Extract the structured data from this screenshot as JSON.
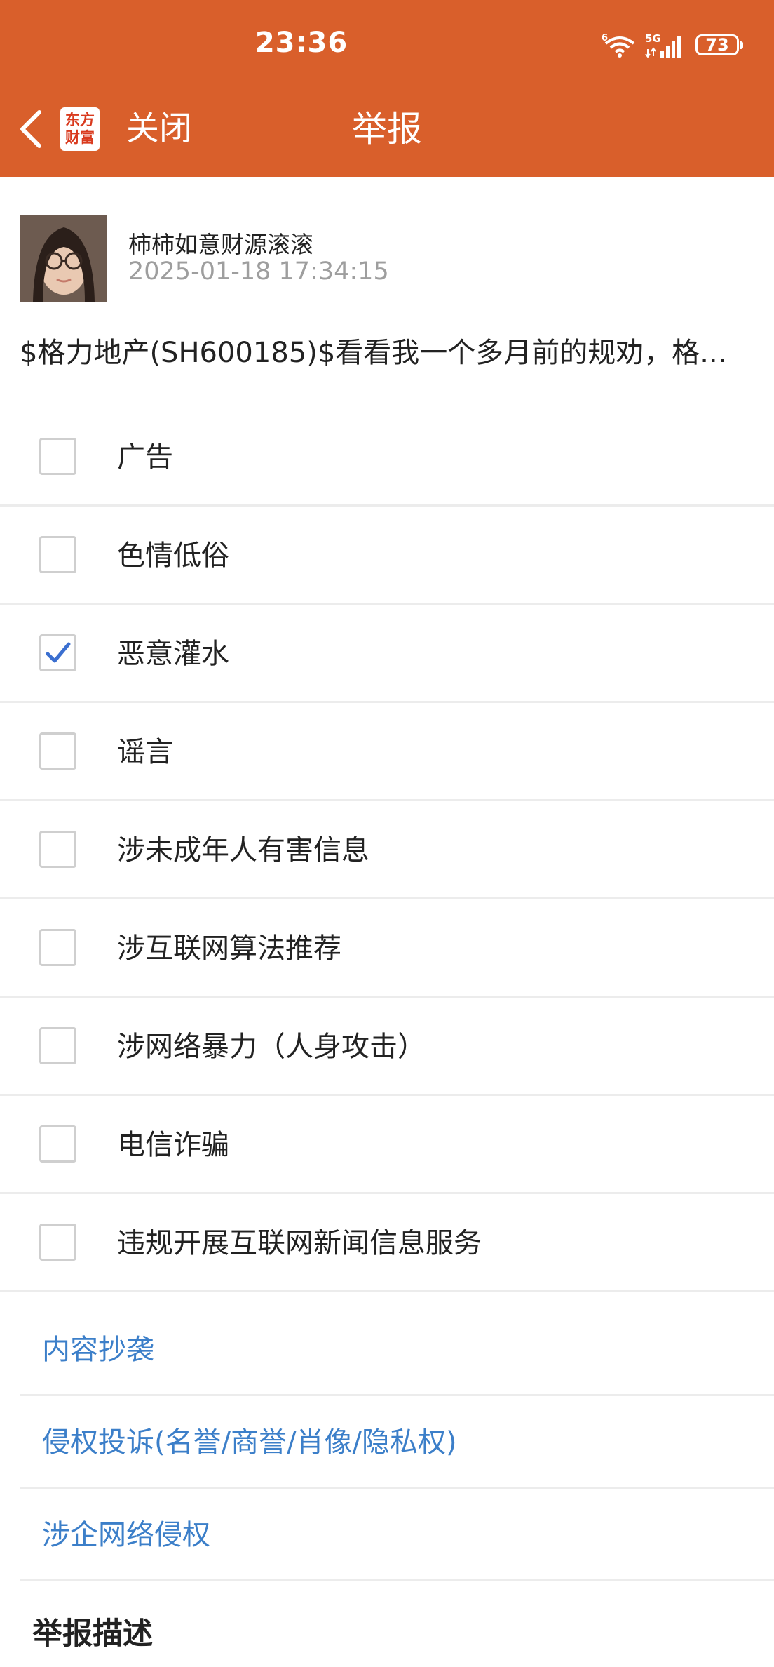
{
  "status_bar": {
    "time": "23:36",
    "battery": "73",
    "network": "5G"
  },
  "nav": {
    "logo_line1": "东方",
    "logo_line2": "财富",
    "close_label": "关闭",
    "title": "举报"
  },
  "post": {
    "author": "柿柿如意财源滚滚",
    "time": "2025-01-18 17:34:15",
    "content": "$格力地产(SH600185)$看看我一个多月前的规劝，格..."
  },
  "report_options": [
    {
      "label": "广告",
      "checked": false
    },
    {
      "label": "色情低俗",
      "checked": false
    },
    {
      "label": "恶意灌水",
      "checked": true
    },
    {
      "label": "谣言",
      "checked": false
    },
    {
      "label": "涉未成年人有害信息",
      "checked": false
    },
    {
      "label": "涉互联网算法推荐",
      "checked": false
    },
    {
      "label": "涉网络暴力（人身攻击）",
      "checked": false
    },
    {
      "label": "电信诈骗",
      "checked": false
    },
    {
      "label": "违规开展互联网新闻信息服务",
      "checked": false
    }
  ],
  "report_links": [
    {
      "label": "内容抄袭"
    },
    {
      "label": "侵权投诉(名誉/商誉/肖像/隐私权)"
    },
    {
      "label": "涉企网络侵权"
    }
  ],
  "description": {
    "title": "举报描述"
  },
  "colors": {
    "header_bg": "#D95F2B",
    "link_blue": "#3C7FC9",
    "check_blue": "#3B6FD0"
  }
}
